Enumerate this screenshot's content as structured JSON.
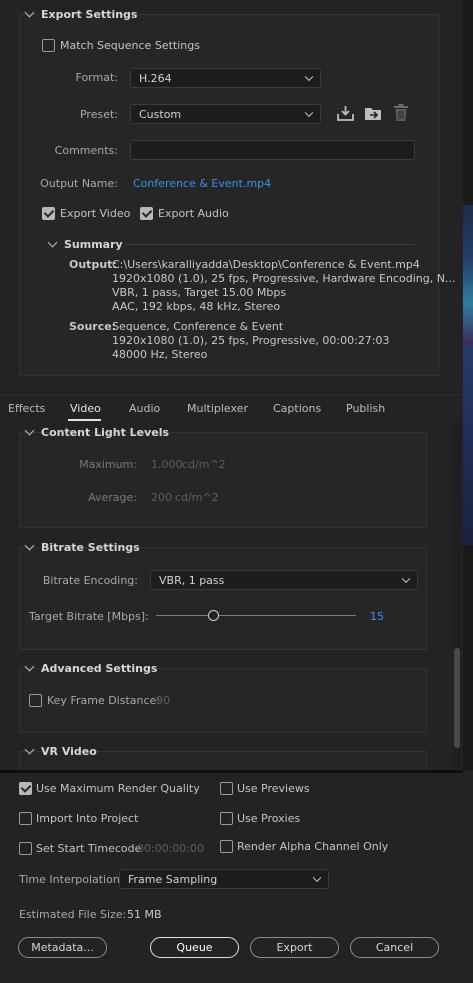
{
  "export_settings": {
    "title": "Export Settings",
    "match_sequence": {
      "label": "Match Sequence Settings",
      "checked": false
    },
    "format": {
      "label": "Format:",
      "value": "H.264"
    },
    "preset": {
      "label": "Preset:",
      "value": "Custom"
    },
    "comments": {
      "label": "Comments:",
      "value": ""
    },
    "output_name": {
      "label": "Output Name:",
      "value": "Conference & Event.mp4"
    },
    "export_video": {
      "label": "Export Video",
      "checked": true
    },
    "export_audio": {
      "label": "Export Audio",
      "checked": true
    },
    "summary": {
      "title": "Summary",
      "output_label": "Output:",
      "output_lines": [
        "C:\\Users\\karalliyadda\\Desktop\\Conference & Event.mp4",
        "1920x1080 (1.0), 25 fps, Progressive, Hardware Encoding, N...",
        "VBR, 1 pass, Target 15.00 Mbps",
        "AAC, 192 kbps, 48 kHz, Stereo"
      ],
      "source_label": "Source:",
      "source_lines": [
        "Sequence, Conference & Event",
        "1920x1080 (1.0), 25 fps, Progressive, 00:00:27:03",
        "48000 Hz, Stereo"
      ]
    }
  },
  "tabs": [
    {
      "label": "Effects",
      "active": false
    },
    {
      "label": "Video",
      "active": true
    },
    {
      "label": "Audio",
      "active": false
    },
    {
      "label": "Multiplexer",
      "active": false
    },
    {
      "label": "Captions",
      "active": false
    },
    {
      "label": "Publish",
      "active": false
    }
  ],
  "content_light": {
    "title": "Content Light Levels",
    "maximum_label": "Maximum:",
    "maximum_value": "1,000",
    "maximum_unit": "cd/m^2",
    "average_label": "Average:",
    "average_value": "200",
    "average_unit": "cd/m^2"
  },
  "bitrate": {
    "title": "Bitrate Settings",
    "encoding_label": "Bitrate Encoding:",
    "encoding_value": "VBR, 1 pass",
    "target_label": "Target Bitrate [Mbps]:",
    "target_value": "15",
    "slider_fraction": 0.29
  },
  "advanced": {
    "title": "Advanced Settings",
    "key_frame_label": "Key Frame Distance:",
    "key_frame_value": "90",
    "key_frame_checked": false
  },
  "vr": {
    "title": "VR Video"
  },
  "bottom": {
    "use_max_render": {
      "label": "Use Maximum Render Quality",
      "checked": true
    },
    "use_previews": {
      "label": "Use Previews",
      "checked": false
    },
    "import_project": {
      "label": "Import Into Project",
      "checked": false
    },
    "use_proxies": {
      "label": "Use Proxies",
      "checked": false
    },
    "set_start_tc": {
      "label": "Set Start Timecode",
      "checked": false,
      "value": "00:00:00:00"
    },
    "render_alpha": {
      "label": "Render Alpha Channel Only",
      "checked": false
    },
    "time_interp_label": "Time Interpolation:",
    "time_interp_value": "Frame Sampling",
    "est_size_label": "Estimated File Size:",
    "est_size_value": "51 MB",
    "buttons": {
      "metadata": "Metadata...",
      "queue": "Queue",
      "export": "Export",
      "cancel": "Cancel"
    }
  }
}
